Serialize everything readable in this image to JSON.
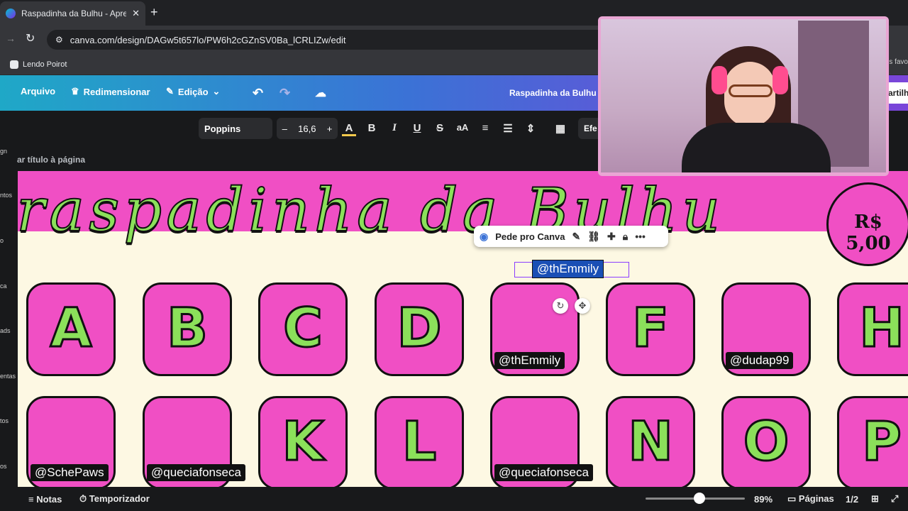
{
  "browser": {
    "tab_title": "Raspadinha da Bulhu - Apresent",
    "url": "canva.com/design/DAGw5t657lo/PW6h2cGZnSV0Ba_lCRLIZw/edit",
    "bookmark": "Lendo Poirot",
    "favorites_tail": "os favo"
  },
  "canva_header": {
    "arquivo": "Arquivo",
    "redimensionar": "Redimensionar",
    "edicao": "Edição",
    "title": "Raspadinha da Bulhu",
    "share": "artilh"
  },
  "toolbar": {
    "font": "Poppins",
    "size": "16,6",
    "minus": "–",
    "plus": "+",
    "efeitos": "Efe"
  },
  "page_title_hint": "ar título à página",
  "left_rail": [
    "gn",
    "ntos",
    "o",
    "ca",
    "ads",
    "entas",
    "tos",
    "os"
  ],
  "design": {
    "title": "raspadinha da Bulhu",
    "price": "R$ 5,00",
    "row1": [
      {
        "letter": "A",
        "tag": ""
      },
      {
        "letter": "B",
        "tag": ""
      },
      {
        "letter": "C",
        "tag": ""
      },
      {
        "letter": "D",
        "tag": ""
      },
      {
        "letter": "",
        "tag": "@thEmmily"
      },
      {
        "letter": "F",
        "tag": ""
      },
      {
        "letter": "",
        "tag": "@dudap99"
      },
      {
        "letter": "H",
        "tag": ""
      }
    ],
    "row2": [
      {
        "letter": "",
        "tag": "@SchePaws"
      },
      {
        "letter": "",
        "tag": "@queciafonseca"
      },
      {
        "letter": "K",
        "tag": ""
      },
      {
        "letter": "L",
        "tag": ""
      },
      {
        "letter": "",
        "tag": "@queciafonseca"
      },
      {
        "letter": "N",
        "tag": ""
      },
      {
        "letter": "O",
        "tag": ""
      },
      {
        "letter": "P",
        "tag": ""
      }
    ],
    "selected_text": "@thEmmily"
  },
  "context_menu": {
    "pede": "Pede pro Canva"
  },
  "bottom": {
    "notas": "Notas",
    "temporizador": "Temporizador",
    "zoom": "89%",
    "paginas": "Páginas",
    "page_count": "1/2"
  },
  "colors": {
    "pink": "#f04fc4",
    "green": "#8be05a",
    "cream": "#fdf8e3"
  }
}
